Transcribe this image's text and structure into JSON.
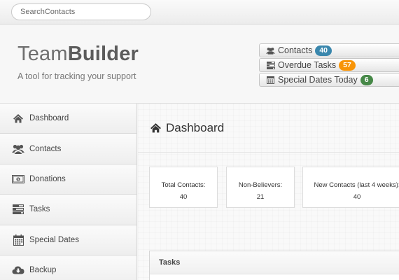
{
  "search": {
    "placeholder": "SearchContacts"
  },
  "brand": {
    "light": "Team",
    "bold": "Builder",
    "tagline": "A tool for tracking your support"
  },
  "header_stats": [
    {
      "label": "Contacts",
      "count": "40",
      "icon": "users-icon",
      "color": "#3a87ad"
    },
    {
      "label": "Overdue Tasks",
      "count": "57",
      "icon": "tasks-icon",
      "color": "#f89406"
    },
    {
      "label": "Special Dates Today",
      "count": "6",
      "icon": "calendar-icon",
      "color": "#468847"
    }
  ],
  "sidebar": {
    "items": [
      {
        "label": "Dashboard",
        "icon": "home-icon"
      },
      {
        "label": "Contacts",
        "icon": "users-icon"
      },
      {
        "label": "Donations",
        "icon": "money-icon"
      },
      {
        "label": "Tasks",
        "icon": "tasks-icon"
      },
      {
        "label": "Special Dates",
        "icon": "calendar-icon"
      },
      {
        "label": "Backup",
        "icon": "cloud-download-icon"
      }
    ]
  },
  "main": {
    "title": "Dashboard",
    "stats": [
      {
        "label": "Total Contacts:",
        "value": "40"
      },
      {
        "label": "Non-Believers:",
        "value": "21"
      },
      {
        "label": "New Contacts (last 4 weeks):",
        "value": "40"
      }
    ],
    "tasks_title": "Tasks"
  }
}
